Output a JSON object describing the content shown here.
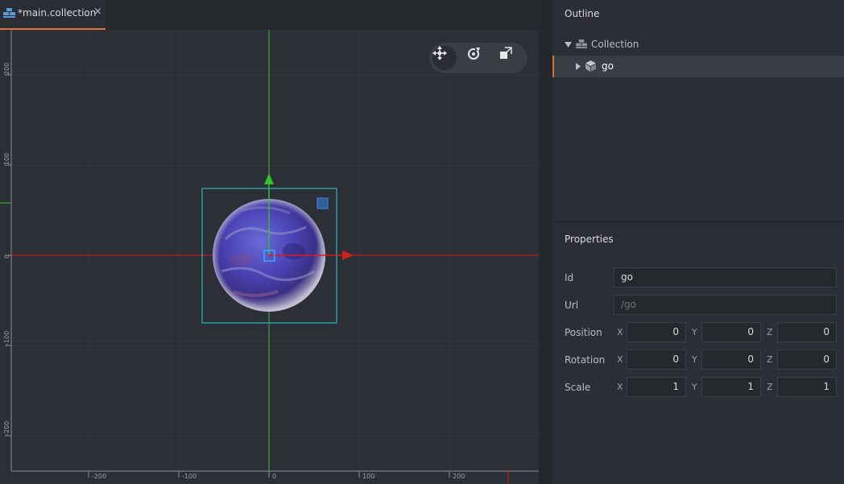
{
  "tab": {
    "title": "*main.collection",
    "close": "×",
    "icon": "collection-icon"
  },
  "viewport": {
    "y_ticks": [
      "200",
      "100",
      "0",
      "-100",
      "-200"
    ],
    "x_ticks": [
      "-200",
      "-100",
      "0",
      "100",
      "200"
    ],
    "toolbar": {
      "move": "move-tool-icon",
      "rotate": "rotate-tool-icon",
      "scale": "scale-tool-icon"
    },
    "colors": {
      "x_axis": "#d21e1e",
      "y_axis": "#2fc12f",
      "selection": "#2ad4d4",
      "manip": "#3f8bd8"
    }
  },
  "outline": {
    "title": "Outline",
    "items": [
      {
        "label": "Collection",
        "icon": "collection-icon",
        "expanded": true
      },
      {
        "label": "go",
        "icon": "game-object-icon",
        "expanded": false,
        "selected": true
      }
    ]
  },
  "properties": {
    "title": "Properties",
    "id_label": "Id",
    "id_value": "go",
    "url_label": "Url",
    "url_placeholder": "/go",
    "axes": {
      "x": "X",
      "y": "Y",
      "z": "Z"
    },
    "position": {
      "label": "Position",
      "x": "0",
      "y": "0",
      "z": "0"
    },
    "rotation": {
      "label": "Rotation",
      "x": "0",
      "y": "0",
      "z": "0"
    },
    "scale": {
      "label": "Scale",
      "x": "1",
      "y": "1",
      "z": "1"
    }
  },
  "accent": "#e0703a"
}
